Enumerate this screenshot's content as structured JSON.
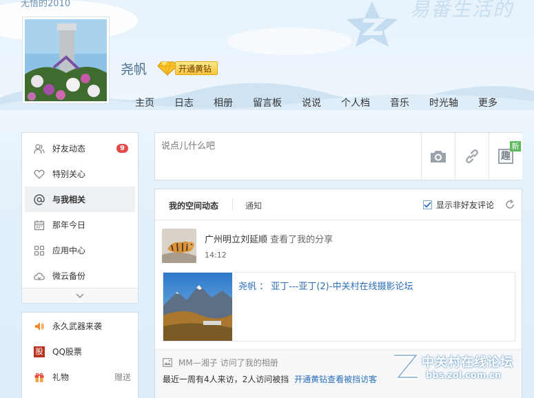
{
  "header": {
    "space_title": "无悟的2010",
    "slogan": "易番生活的",
    "username": "尧帆",
    "vip_label": "开通黄钻",
    "nav": [
      "主页",
      "日志",
      "相册",
      "留言板",
      "说说",
      "个人档",
      "音乐",
      "时光轴",
      "更多"
    ]
  },
  "sidebar": {
    "items": [
      {
        "label": "好友动态",
        "icon": "friends-icon",
        "badge": "9"
      },
      {
        "label": "特别关心",
        "icon": "heart-icon"
      },
      {
        "label": "与我相关",
        "icon": "at-icon",
        "active": true
      },
      {
        "label": "那年今日",
        "icon": "calendar-icon"
      },
      {
        "label": "应用中心",
        "icon": "apps-icon"
      },
      {
        "label": "微云备份",
        "icon": "cloud-icon"
      }
    ],
    "apps": [
      {
        "label": "永久武器来袭",
        "icon": "game-icon"
      },
      {
        "label": "QQ股票",
        "icon": "stock-icon",
        "icon_text": "股"
      },
      {
        "label": "礼物",
        "icon": "gift-icon",
        "side_link": "赠送"
      }
    ]
  },
  "composer": {
    "placeholder": "说点儿什么吧",
    "fun_icon_text": "趣",
    "new_tag": "新"
  },
  "feed": {
    "tab_active": "我的空间动态",
    "tab_other": "通知",
    "checkbox_label": "显示非好友评论",
    "checkbox_checked": true,
    "item": {
      "user": "广州明立刘延顺",
      "action": "查看了我的分享",
      "time": "14:12",
      "share_text": "尧帆 ： 亚丁---亚丁(2)-中关村在线摄影论坛"
    },
    "visits": {
      "line1_user": "MM—湘子",
      "line1_action": "访问了我的相册",
      "summary": "最近一周有4人来访，2人访问被挡",
      "link": "开通黄钻查看被挡访客"
    }
  },
  "watermark": {
    "title": "中关村在线论坛",
    "url": "bbs.zol.com.cn"
  },
  "colors": {
    "link": "#2a6ebb",
    "badge": "#e34b4b",
    "vip_gold": "#f7c53a",
    "new_green": "#5cb85c"
  }
}
